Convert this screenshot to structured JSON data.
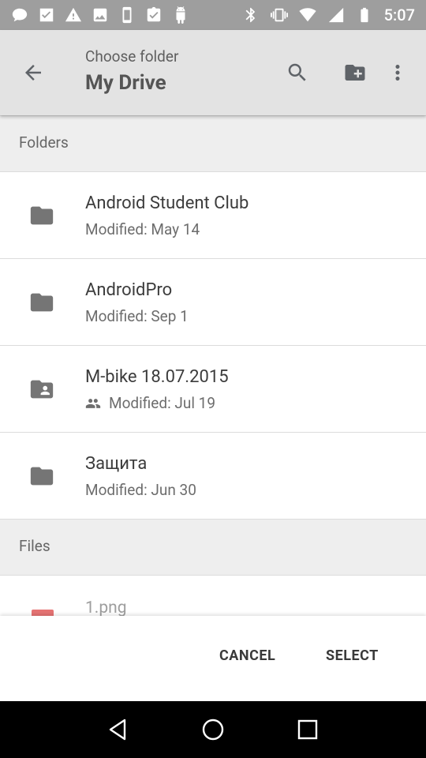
{
  "status_bar": {
    "time": "5:07",
    "left_icons": [
      "chat-icon",
      "checkmark-icon",
      "warning-icon",
      "image-icon",
      "phone-icon",
      "clipboard-check-icon",
      "android-icon"
    ],
    "right_icons": [
      "bluetooth-icon",
      "vibrate-icon",
      "wifi-icon",
      "cell-signal-icon",
      "battery-icon"
    ]
  },
  "appbar": {
    "subtitle": "Choose folder",
    "title": "My Drive",
    "actions": [
      "search-icon",
      "new-folder-icon",
      "more-vert-icon"
    ]
  },
  "folders_section": {
    "label": "Folders",
    "items": [
      {
        "name": "Android Student Club",
        "modified": "Modified: May 14",
        "icon": "folder-icon",
        "shared": false
      },
      {
        "name": "AndroidPro",
        "modified": "Modified: Sep 1",
        "icon": "folder-icon",
        "shared": false
      },
      {
        "name": "M-bike 18.07.2015",
        "modified": "Modified: Jul 19",
        "icon": "shared-folder-icon",
        "shared": true
      },
      {
        "name": "Защита",
        "modified": "Modified: Jun 30",
        "icon": "folder-icon",
        "shared": false
      }
    ]
  },
  "files_section": {
    "label": "Files",
    "items": [
      {
        "name": "1.png",
        "icon": "image-file-icon"
      }
    ]
  },
  "buttons": {
    "cancel": "CANCEL",
    "select": "SELECT"
  },
  "colors": {
    "status_bar": "#9e9e9e",
    "appbar": "#e3e3e3",
    "section_header": "#eeeeee",
    "image_thumb": "#e57373"
  }
}
